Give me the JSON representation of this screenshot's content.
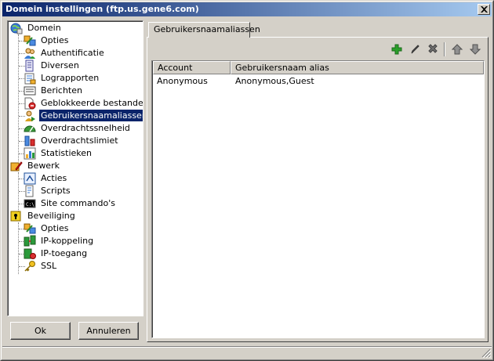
{
  "window": {
    "title": "Domein instellingen (ftp.us.gene6.com)"
  },
  "tree": {
    "domain": {
      "label": "Domein",
      "children": [
        {
          "label": "Opties",
          "icon": "options-icon"
        },
        {
          "label": "Authentificatie",
          "icon": "users-icon"
        },
        {
          "label": "Diversen",
          "icon": "misc-icon"
        },
        {
          "label": "Lograpporten",
          "icon": "log-icon"
        },
        {
          "label": "Berichten",
          "icon": "messages-icon"
        },
        {
          "label": "Geblokkeerde bestanden",
          "icon": "blocked-files-icon"
        },
        {
          "label": "Gebruikersnaamaliassen",
          "icon": "user-alias-icon"
        },
        {
          "label": "Overdrachtssnelheid",
          "icon": "speed-gauge-icon"
        },
        {
          "label": "Overdrachtslimiet",
          "icon": "limit-icon"
        },
        {
          "label": "Statistieken",
          "icon": "statistics-icon"
        }
      ]
    },
    "edit": {
      "label": "Bewerk",
      "children": [
        {
          "label": "Acties",
          "icon": "actions-icon"
        },
        {
          "label": "Scripts",
          "icon": "scripts-icon"
        },
        {
          "label": "Site commando's",
          "icon": "console-icon"
        }
      ]
    },
    "security": {
      "label": "Beveiliging",
      "children": [
        {
          "label": "Opties",
          "icon": "options-icon"
        },
        {
          "label": "IP-koppeling",
          "icon": "ip-binding-icon"
        },
        {
          "label": "IP-toegang",
          "icon": "ip-access-icon"
        },
        {
          "label": "SSL",
          "icon": "key-icon"
        }
      ]
    }
  },
  "buttons": {
    "ok": "Ok",
    "cancel": "Annuleren"
  },
  "tab": {
    "label": "Gebruikersnaamaliassen"
  },
  "list": {
    "columns": [
      "Account",
      "Gebruikersnaam alias"
    ],
    "rows": [
      [
        "Anonymous",
        "Anonymous,Guest"
      ]
    ]
  }
}
